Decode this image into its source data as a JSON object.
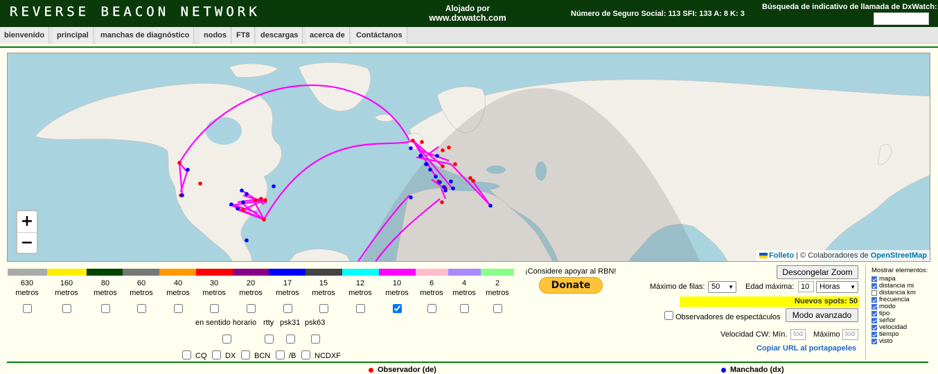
{
  "header": {
    "logo": "REVERSE BEACON NETWORK",
    "hosted_line1": "Alojado por",
    "hosted_line2": "www.dxwatch.com",
    "solar": "Número de Seguro Social: 113 SFI: 133 A: 8 K: 3",
    "callsign_search_label": "Búsqueda de indicativo de llamada de DxWatch:",
    "callsign_search_value": ""
  },
  "nav": {
    "items": [
      "bienvenido",
      "principal",
      "manchas de diagnóstico",
      "nodos",
      "FT8",
      "descargas",
      "acerca de",
      "Contáctanos"
    ]
  },
  "map": {
    "zoom_in": "+",
    "zoom_out": "−",
    "attribution_leaflet": "Folleto",
    "attribution_sep": " | © Colaboradores de ",
    "attribution_osm": "OpenStreetMap",
    "observer_color": "#ff0000",
    "spotted_color": "#0000ff",
    "path_color": "#ff00ff"
  },
  "bands": {
    "items": [
      {
        "value": "630",
        "unit": "metros",
        "color": "#aaaaaa",
        "checked": false
      },
      {
        "value": "160",
        "unit": "metros",
        "color": "#ffee00",
        "checked": false
      },
      {
        "value": "80",
        "unit": "metros",
        "color": "#004400",
        "checked": false
      },
      {
        "value": "60",
        "unit": "metros",
        "color": "#777777",
        "checked": false
      },
      {
        "value": "40",
        "unit": "metros",
        "color": "#ff9900",
        "checked": false
      },
      {
        "value": "30",
        "unit": "metros",
        "color": "#ff0000",
        "checked": false
      },
      {
        "value": "20",
        "unit": "metros",
        "color": "#880088",
        "checked": false
      },
      {
        "value": "17",
        "unit": "metros",
        "color": "#0000ff",
        "checked": false
      },
      {
        "value": "15",
        "unit": "metros",
        "color": "#444444",
        "checked": false
      },
      {
        "value": "12",
        "unit": "metros",
        "color": "#00ffff",
        "checked": false
      },
      {
        "value": "10",
        "unit": "metros",
        "color": "#ff00ff",
        "checked": true
      },
      {
        "value": "6",
        "unit": "metros",
        "color": "#ffbbcc",
        "checked": false
      },
      {
        "value": "4",
        "unit": "metros",
        "color": "#aa88ff",
        "checked": false
      },
      {
        "value": "2",
        "unit": "metros",
        "color": "#88ff88",
        "checked": false
      }
    ]
  },
  "modes": {
    "row1": [
      "en sentido horario",
      "rtty",
      "psk31",
      "psk63"
    ],
    "row2": [
      "CQ",
      "DX",
      "BCN",
      "/B",
      "NCDXF"
    ]
  },
  "support": {
    "text": "¡Considere apoyar al RBN!",
    "donate": "Donate"
  },
  "controls": {
    "unfreeze": "Descongelar Zoom",
    "max_rows_label": "Máximo de filas:",
    "max_rows_value": "50",
    "max_age_label": "Edad máxima:",
    "max_age_value": "10",
    "max_age_unit": "Horas",
    "new_spots": "Nuevos spots: 50",
    "show_observers": "Observadores de espectáculos",
    "advanced": "Modo avanzado",
    "cw_speed_label": "Velocidad CW: Mín.",
    "cw_min_placeholder": "tod",
    "cw_max_label": "Máximo",
    "cw_max_placeholder": "tod",
    "copy_url": "Copiar URL al portapapeles"
  },
  "show_elements": {
    "title": "Mostrar elementos:",
    "items": [
      {
        "label": "mapa",
        "checked": true
      },
      {
        "label": "distancia mi",
        "checked": true
      },
      {
        "label": "distancia km",
        "checked": false
      },
      {
        "label": "frecuencia",
        "checked": true
      },
      {
        "label": "modo",
        "checked": true
      },
      {
        "label": "tipo",
        "checked": true
      },
      {
        "label": "señor",
        "checked": true
      },
      {
        "label": "velocidad",
        "checked": true
      },
      {
        "label": "tiempo",
        "checked": true
      },
      {
        "label": "visto",
        "checked": true
      }
    ]
  },
  "legend": {
    "observer": "Observador (de)",
    "spotted": "Manchado (dx)"
  }
}
